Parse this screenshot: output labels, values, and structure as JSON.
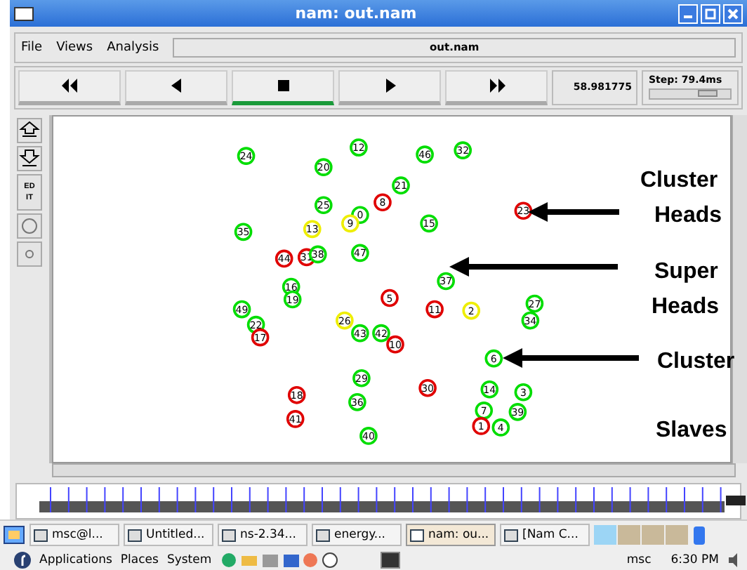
{
  "window": {
    "title": "nam: out.nam"
  },
  "menu": [
    {
      "label": "File"
    },
    {
      "label": "Views"
    },
    {
      "label": "Analysis"
    }
  ],
  "file_field": {
    "value": "out.nam"
  },
  "playback": [
    {
      "kind": "rewind",
      "selected": false
    },
    {
      "kind": "back",
      "selected": false
    },
    {
      "kind": "stop",
      "selected": true
    },
    {
      "kind": "play",
      "selected": false
    },
    {
      "kind": "forward",
      "selected": false
    }
  ],
  "time": "58.981775",
  "step": {
    "label": "Step: 79.4ms",
    "level": 0.8
  },
  "edit_tool": {
    "label": "ED IT"
  },
  "nodes": [
    {
      "label": "24",
      "color": "#00dd00"
    },
    {
      "label": "12",
      "color": "#00dd00"
    },
    {
      "label": "46",
      "color": "#00dd00"
    },
    {
      "label": "32",
      "color": "#00dd00"
    },
    {
      "label": "20",
      "color": "#00dd00"
    },
    {
      "label": "21",
      "color": "#00dd00"
    },
    {
      "label": "25",
      "color": "#00dd00"
    },
    {
      "label": "8",
      "color": "#e00000"
    },
    {
      "label": "23",
      "color": "#e00000"
    },
    {
      "label": "0",
      "color": "#00dd00"
    },
    {
      "label": "35",
      "color": "#00dd00"
    },
    {
      "label": "13",
      "color": "#eeee00"
    },
    {
      "label": "9",
      "color": "#eeee00"
    },
    {
      "label": "15",
      "color": "#00dd00"
    },
    {
      "label": "44",
      "color": "#e00000"
    },
    {
      "label": "31",
      "color": "#e00000"
    },
    {
      "label": "38",
      "color": "#00dd00"
    },
    {
      "label": "47",
      "color": "#00dd00"
    },
    {
      "label": "37",
      "color": "#00dd00"
    },
    {
      "label": "16",
      "color": "#00dd00"
    },
    {
      "label": "49",
      "color": "#00dd00"
    },
    {
      "label": "19",
      "color": "#00dd00"
    },
    {
      "label": "5",
      "color": "#e00000"
    },
    {
      "label": "11",
      "color": "#e00000"
    },
    {
      "label": "2",
      "color": "#eeee00"
    },
    {
      "label": "27",
      "color": "#00dd00"
    },
    {
      "label": "22",
      "color": "#00dd00"
    },
    {
      "label": "26",
      "color": "#eeee00"
    },
    {
      "label": "34",
      "color": "#00dd00"
    },
    {
      "label": "17",
      "color": "#e00000"
    },
    {
      "label": "43",
      "color": "#00dd00"
    },
    {
      "label": "42",
      "color": "#00dd00"
    },
    {
      "label": "10",
      "color": "#e00000"
    },
    {
      "label": "6",
      "color": "#00dd00"
    },
    {
      "label": "29",
      "color": "#00dd00"
    },
    {
      "label": "18",
      "color": "#e00000"
    },
    {
      "label": "30",
      "color": "#e00000"
    },
    {
      "label": "14",
      "color": "#00dd00"
    },
    {
      "label": "3",
      "color": "#00dd00"
    },
    {
      "label": "36",
      "color": "#00dd00"
    },
    {
      "label": "7",
      "color": "#00dd00"
    },
    {
      "label": "39",
      "color": "#00dd00"
    },
    {
      "label": "41",
      "color": "#e00000"
    },
    {
      "label": "1",
      "color": "#e00000"
    },
    {
      "label": "4",
      "color": "#00dd00"
    },
    {
      "label": "40",
      "color": "#00dd00"
    }
  ],
  "annotations": [
    {
      "lines": [
        "Cluster",
        "Heads"
      ]
    },
    {
      "lines": [
        "Super",
        "Heads"
      ]
    },
    {
      "lines": [
        "Cluster"
      ]
    },
    {
      "lines": [
        "Slaves"
      ]
    }
  ],
  "taskbar": [
    {
      "label": "msc@l...",
      "selected": false
    },
    {
      "label": "Untitled...",
      "selected": false
    },
    {
      "label": "ns-2.34...",
      "selected": false
    },
    {
      "label": "energy...",
      "selected": false
    },
    {
      "label": "nam: ou...",
      "selected": true
    },
    {
      "label": "[Nam C...",
      "selected": false
    }
  ],
  "panel": {
    "menus": [
      "Applications",
      "Places",
      "System"
    ],
    "user": "msc",
    "clock": "6:30 PM"
  }
}
